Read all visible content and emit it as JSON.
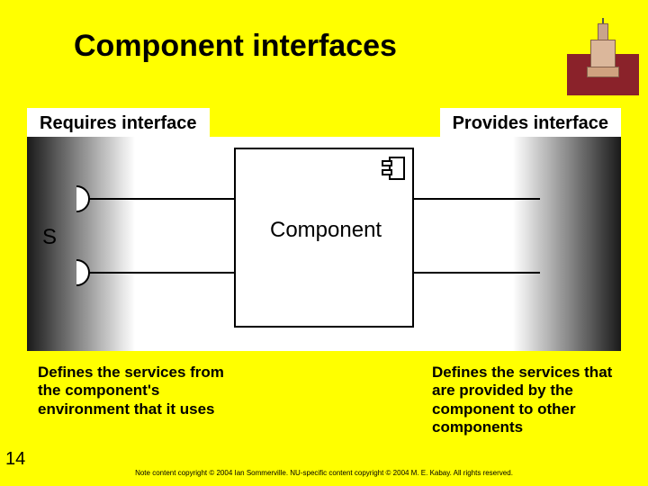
{
  "title": "Component interfaces",
  "labels": {
    "requires": "Requires interface",
    "provides": "Provides interface",
    "component": "Component",
    "s": "S"
  },
  "descriptions": {
    "requires": "Defines the services from the component's environment that it uses",
    "provides": "Defines the services that are provided by the component to other components"
  },
  "page_number": "14",
  "footer": "Note content copyright © 2004 Ian Sommerville.  NU-specific content copyright © 2004 M. E. Kabay.  All rights reserved."
}
